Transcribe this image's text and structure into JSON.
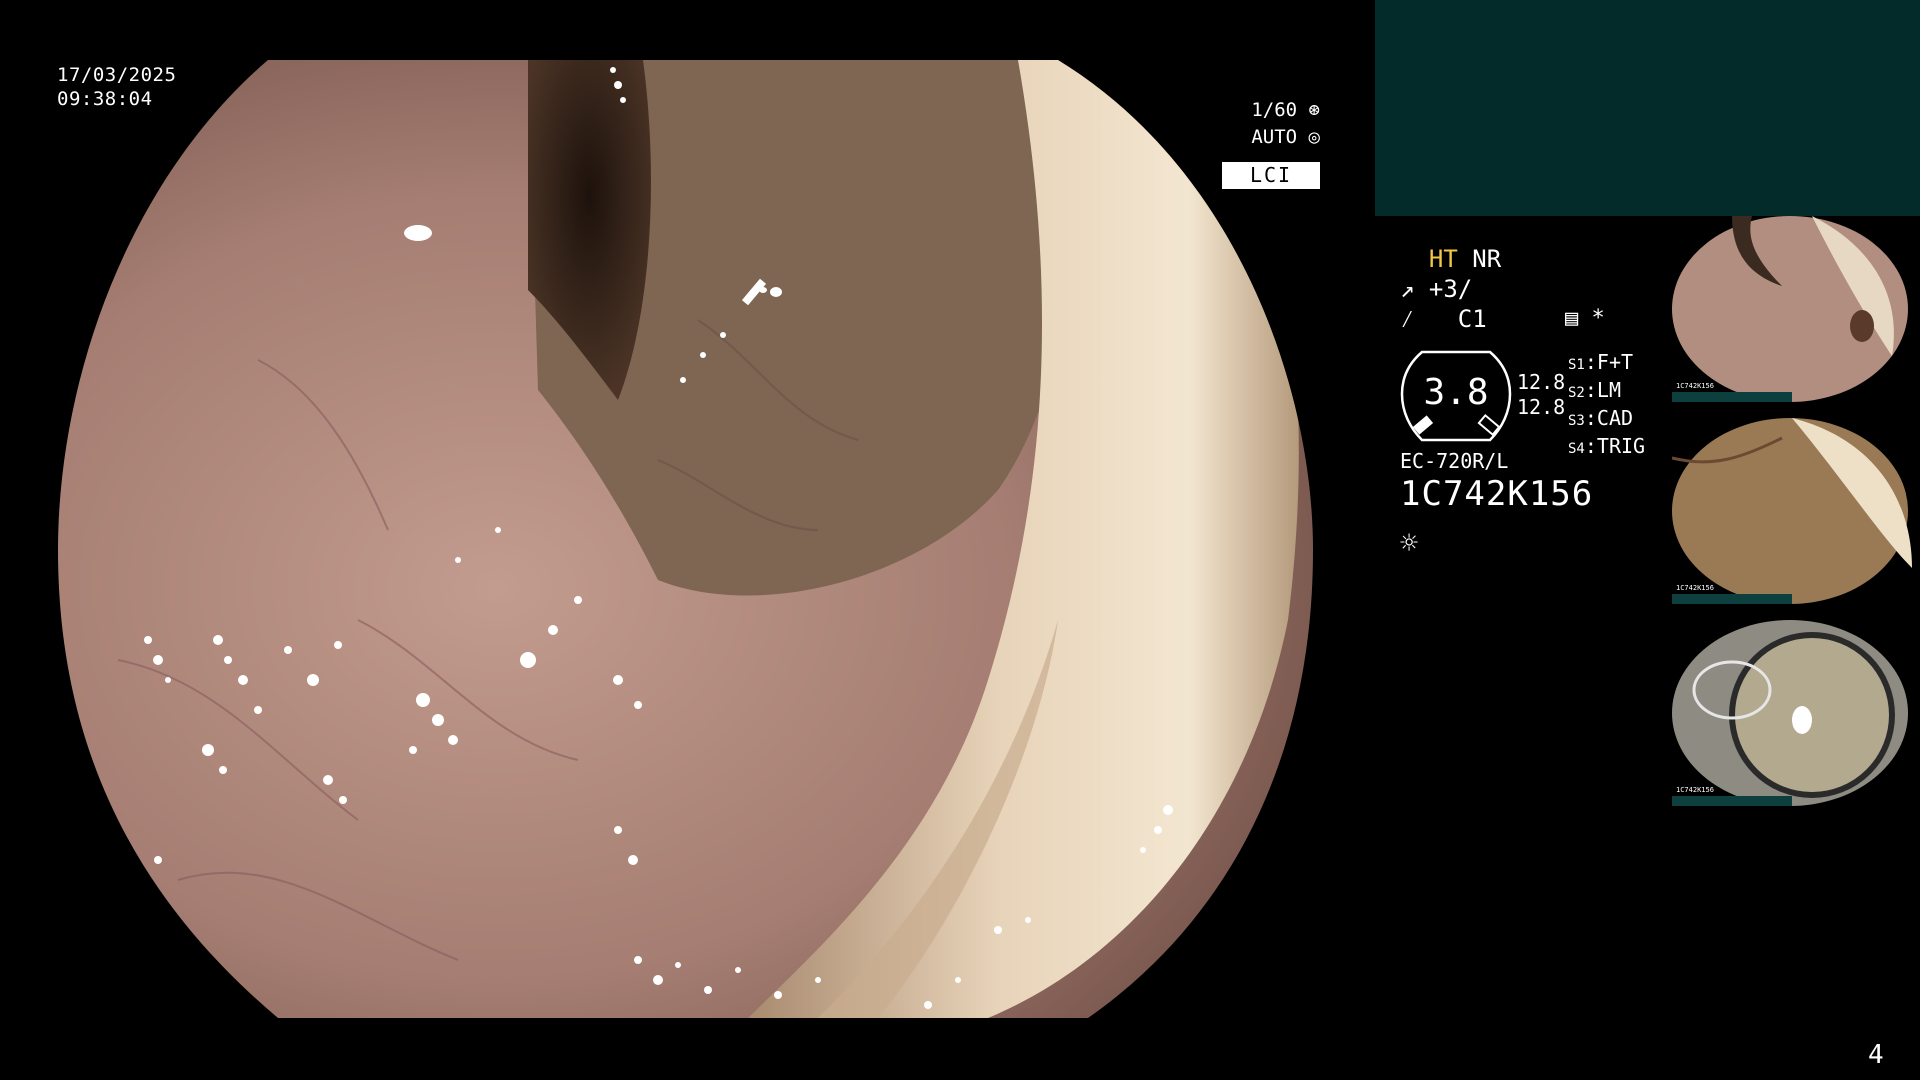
{
  "overlay": {
    "date": "17/03/2025",
    "time": "09:38:04",
    "shutter": "1/60",
    "iris": "AUTO",
    "mode": "LCI"
  },
  "settings": {
    "ht": "HT",
    "nr": "NR",
    "enhancement": "+3/",
    "color": "C1",
    "star": "*"
  },
  "dial": {
    "value": "3.8",
    "val1": "12.8",
    "val2": "12.8"
  },
  "switches": [
    {
      "key": "S1",
      "value": "F+T"
    },
    {
      "key": "S2",
      "value": "LM"
    },
    {
      "key": "S3",
      "value": "CAD"
    },
    {
      "key": "S4",
      "value": "TRIG"
    }
  ],
  "scope": {
    "model": "EC-720R/L",
    "serial": "1C742K156"
  },
  "thumbnails": [
    {
      "label": "1C742K156"
    },
    {
      "label": "1C742K156"
    },
    {
      "label": "1C742K156"
    }
  ],
  "icons": {
    "shutter": "shutter-icon",
    "iris": "iris-icon",
    "light": "light-icon",
    "enhance": "enhance-icon",
    "color": "color-icon",
    "record": "record-icon"
  },
  "colors": {
    "panel": "#022b2a",
    "accent": "#f2c744"
  },
  "page": "4"
}
